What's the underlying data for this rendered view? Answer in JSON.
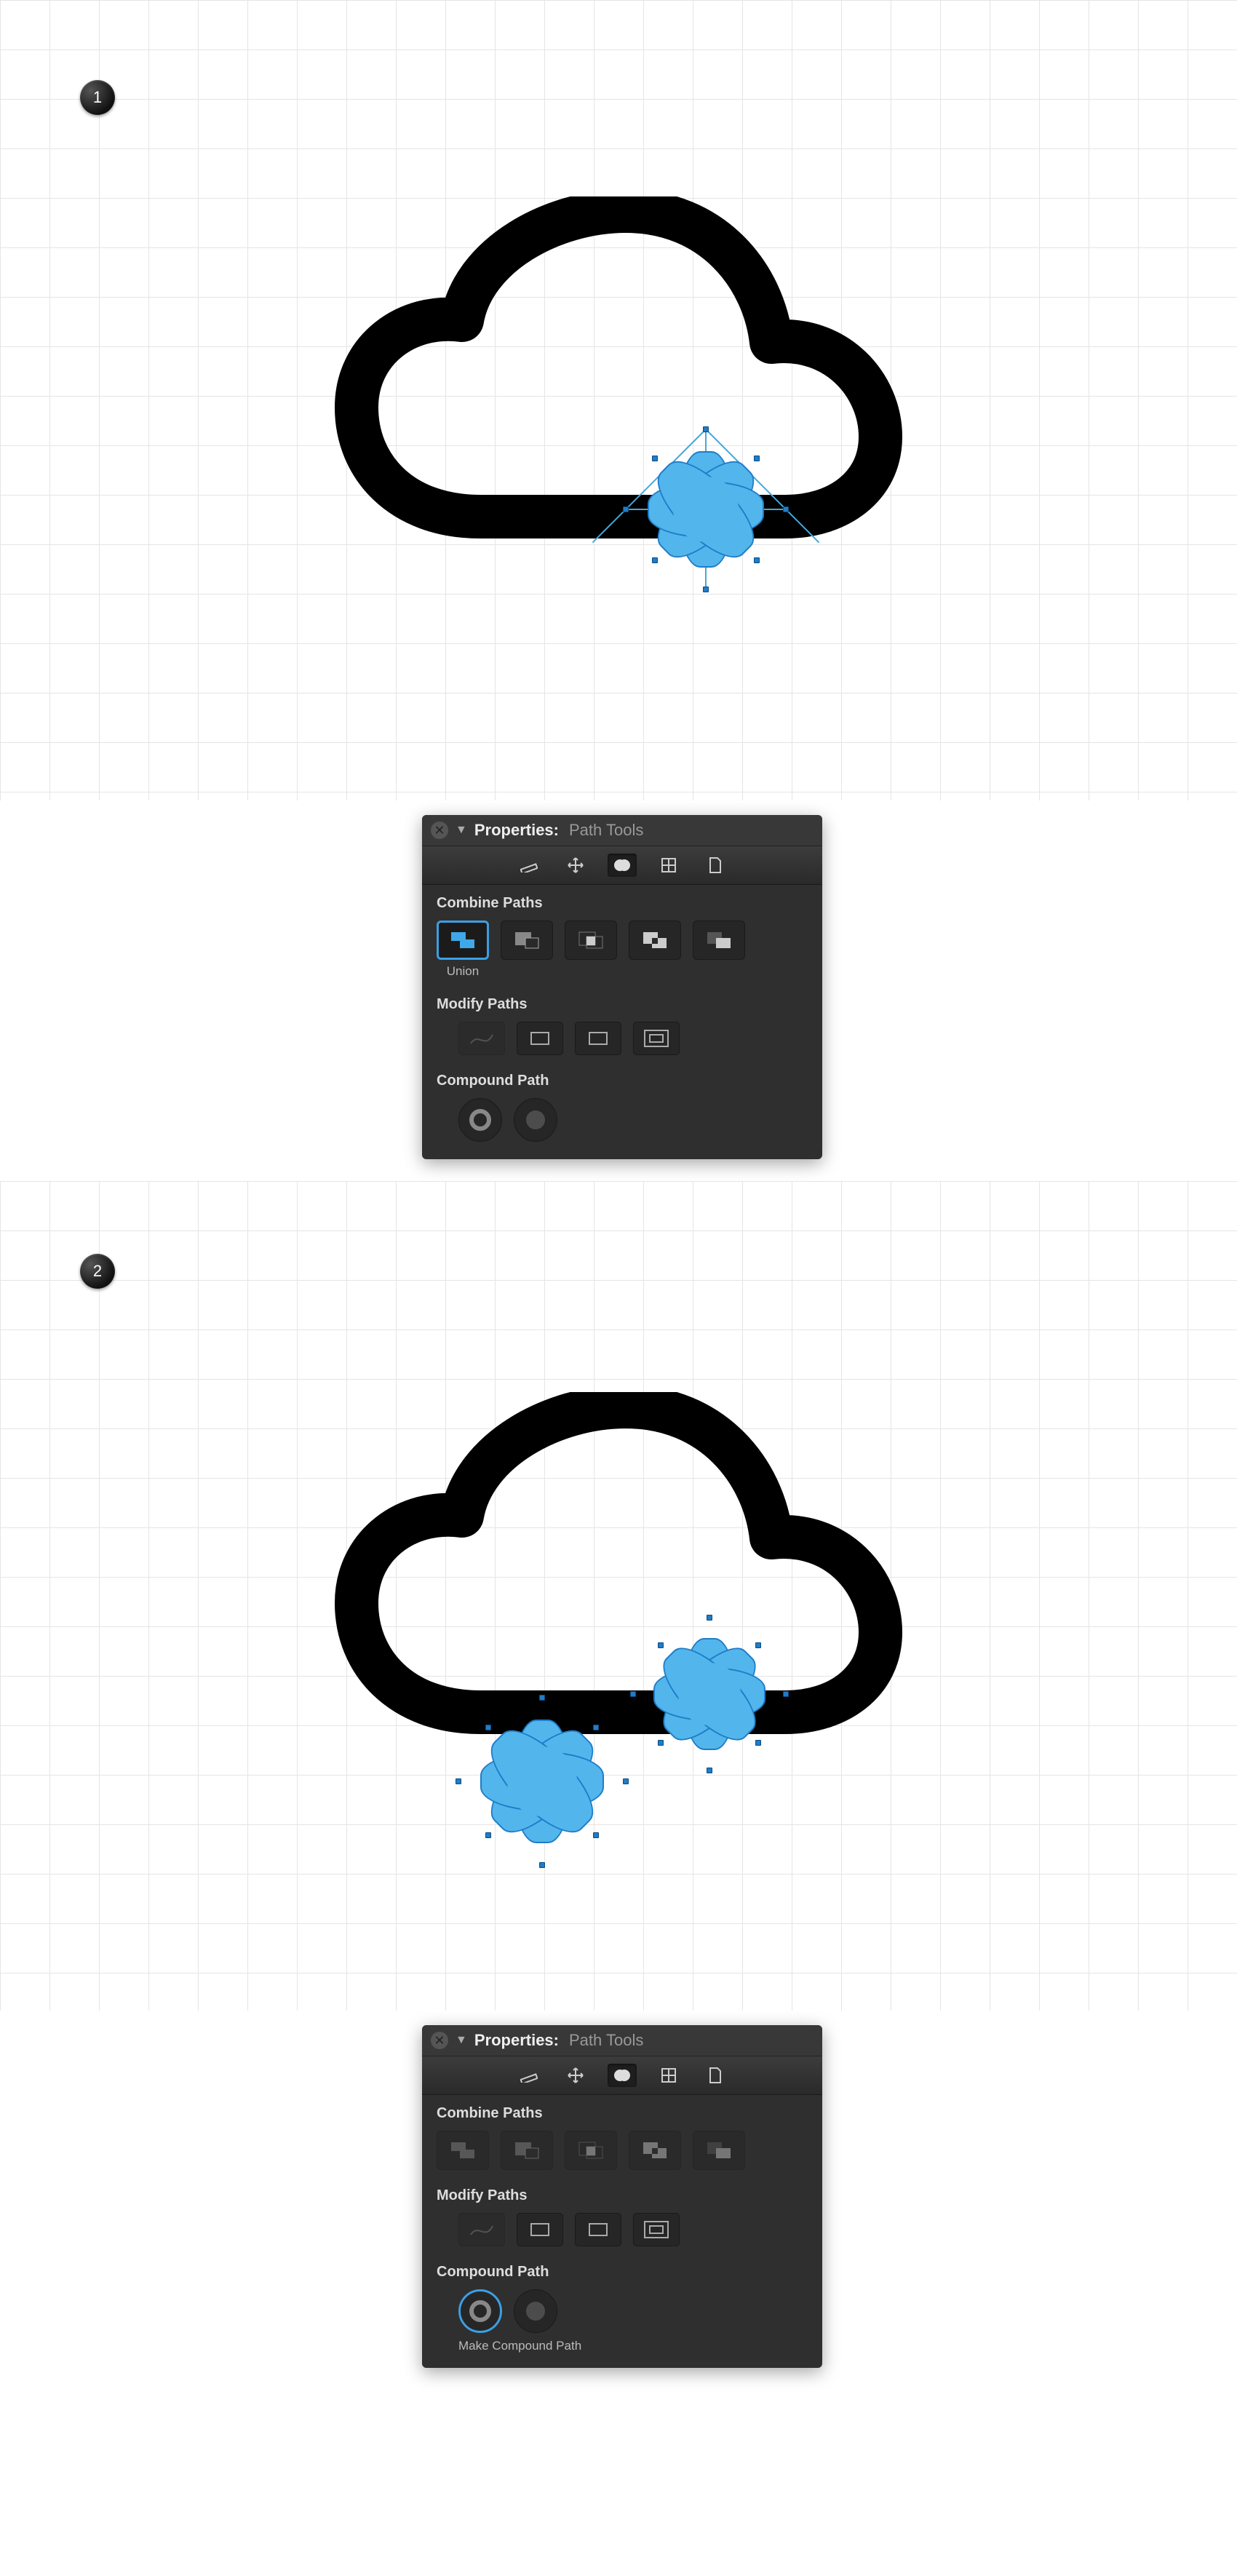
{
  "steps": [
    {
      "badge": "1"
    },
    {
      "badge": "2"
    }
  ],
  "panel": {
    "title": "Properties:",
    "subtitle": "Path Tools",
    "sections": {
      "combine": "Combine Paths",
      "modify": "Modify Paths",
      "compound": "Compound Path"
    },
    "tool_captions": {
      "union": "Union",
      "make_compound": "Make Compound Path"
    }
  },
  "snowflake": {
    "fill": "#52B6EC",
    "stroke": "#1F7CC8"
  }
}
